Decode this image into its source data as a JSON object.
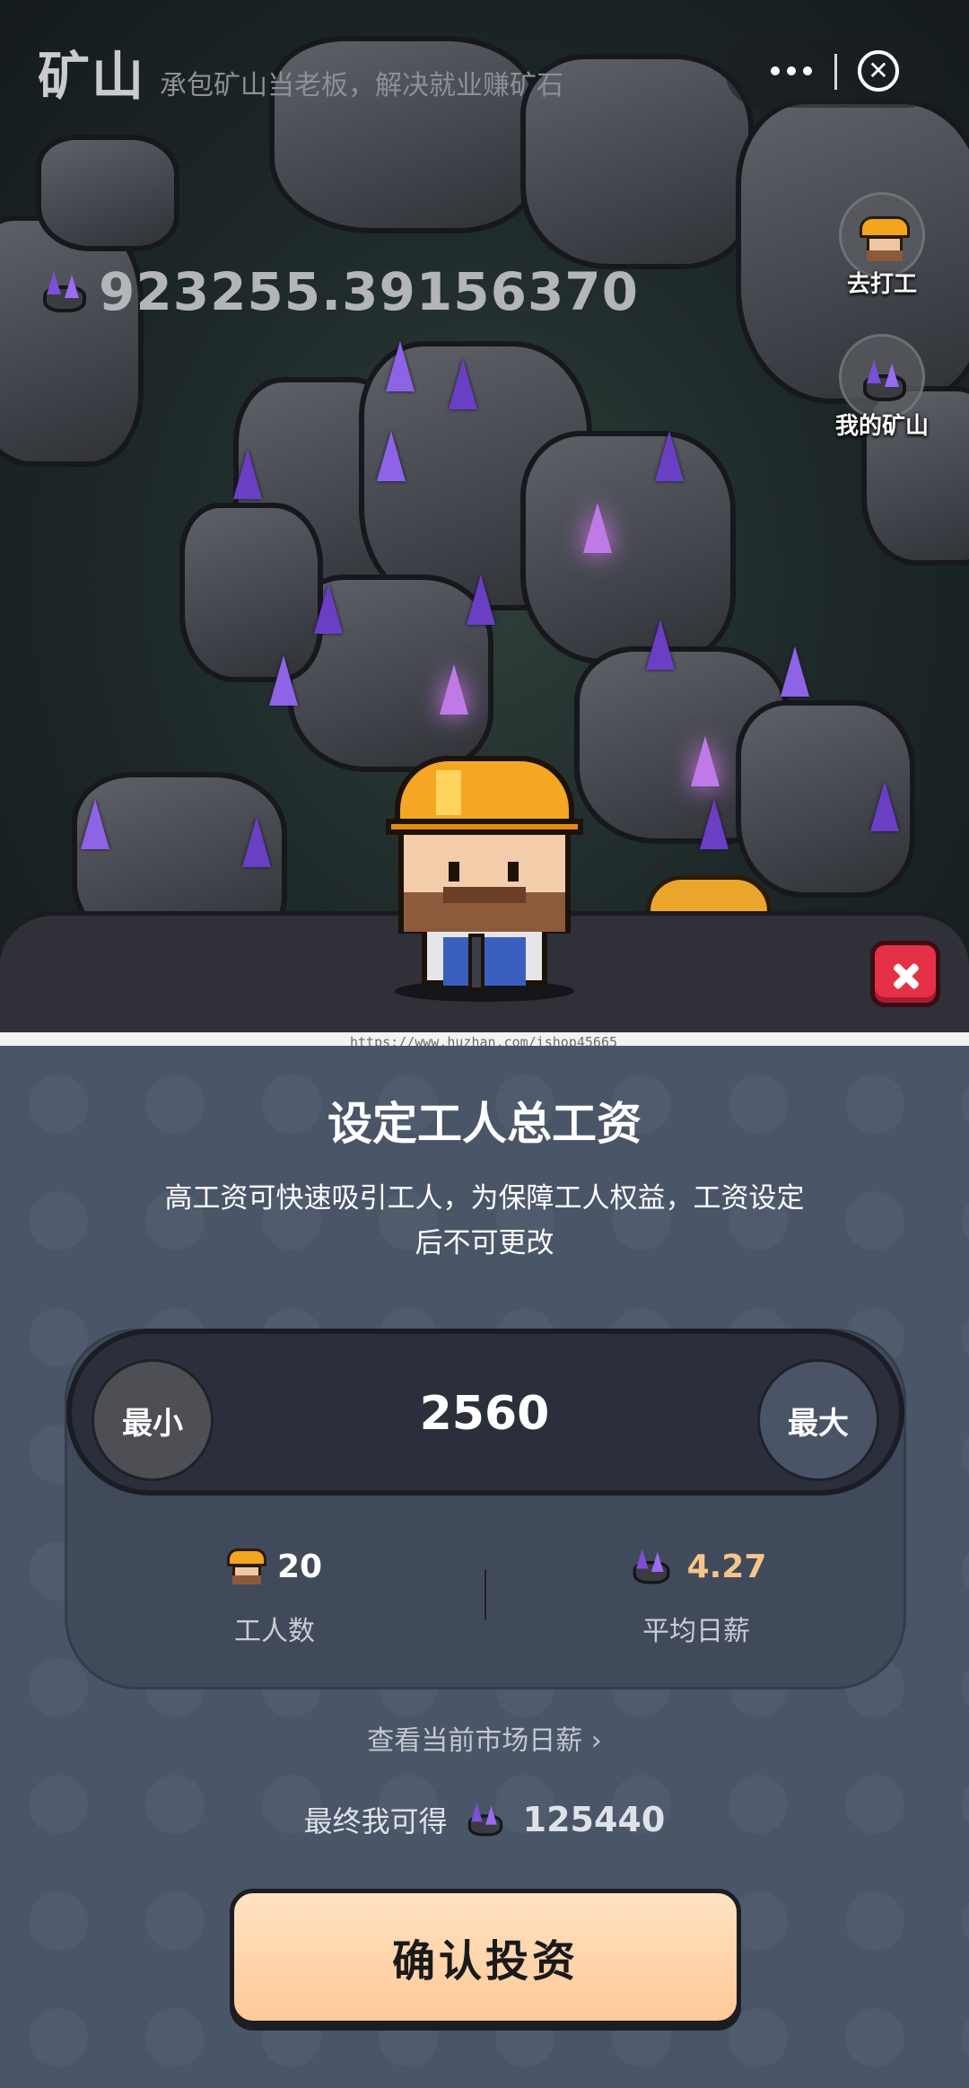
{
  "header": {
    "title": "矿山",
    "subtitle": "承包矿山当老板，解决就业赚矿石"
  },
  "balance": {
    "value": "923255.39156370",
    "icon": "ore-crystal-icon"
  },
  "side_buttons": {
    "work": {
      "label": "去打工",
      "icon": "miner-helmet-icon"
    },
    "my_mine": {
      "label": "我的矿山",
      "icon": "ore-crystal-icon"
    }
  },
  "watermark": "https://www.huzhan.com/ishop45665",
  "panel": {
    "title": "设定工人总工资",
    "description": "高工资可快速吸引工人，为保障工人权益，工资设定后不可更改",
    "stepper": {
      "min_label": "最小",
      "max_label": "最大",
      "value": "2560"
    },
    "stats": {
      "workers": {
        "value": "20",
        "label": "工人数",
        "color": "#ffffff"
      },
      "daily_wage": {
        "value": "4.27",
        "label": "平均日薪",
        "color": "#f6c58a"
      }
    },
    "market_link": "查看当前市场日薪 ›",
    "final": {
      "label": "最终我可得",
      "value": "125440"
    },
    "confirm_label": "确认投资"
  },
  "colors": {
    "accent_orange": "#ffc998",
    "close_red": "#e53047",
    "panel_bg": "#4a5568"
  }
}
